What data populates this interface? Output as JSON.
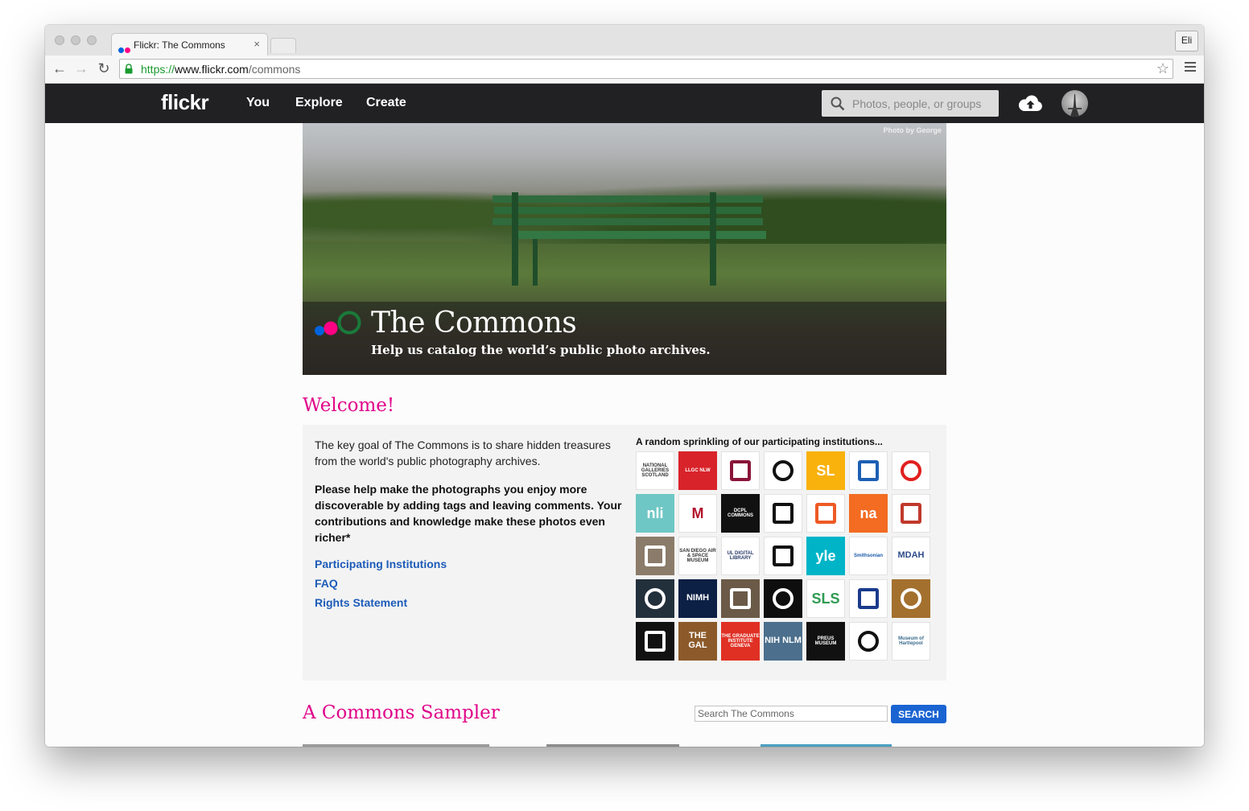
{
  "browser": {
    "tab_title": "Flickr: The Commons",
    "tab_close": "×",
    "profile_name": "Eli",
    "url_scheme": "https://",
    "url_host": "www.flickr.com",
    "url_path": "/commons",
    "nav_back": "←",
    "nav_forward": "→",
    "nav_reload": "↻",
    "star": "☆"
  },
  "flickr_header": {
    "logo": "flickr",
    "nav": [
      "You",
      "Explore",
      "Create"
    ],
    "search_placeholder": "Photos, people, or groups"
  },
  "hero": {
    "credit": "Photo by George",
    "title": "The Commons",
    "subtitle": "Help us catalog the world’s public photo archives."
  },
  "welcome": {
    "heading": "Welcome!",
    "intro": "The key goal of The Commons is to share hidden treasures from the world's public photography archives.",
    "call_to_action": "Please help make the photographs you enjoy more discoverable by adding tags and leaving comments. Your contributions and knowledge make these photos even richer*",
    "links": [
      "Participating Institutions",
      "FAQ",
      "Rights Statement"
    ],
    "institutions_heading": "A random sprinkling of our participating institutions...",
    "institutions": [
      {
        "text": "NATIONAL GALLERIES SCOTLAND",
        "bg": "#ffffff",
        "fg": "#333333"
      },
      {
        "text": "LLGC NLW",
        "bg": "#d8232a",
        "fg": "#ffffff"
      },
      {
        "text": "",
        "bg": "#ffffff",
        "fg": "#8a1538"
      },
      {
        "text": "",
        "bg": "#ffffff",
        "fg": "#111111"
      },
      {
        "text": "SL",
        "bg": "#f9b10b",
        "fg": "#ffffff"
      },
      {
        "text": "",
        "bg": "#ffffff",
        "fg": "#1d5fb4"
      },
      {
        "text": "",
        "bg": "#ffffff",
        "fg": "#e0201f"
      },
      {
        "text": "nli",
        "bg": "#6ec7c4",
        "fg": "#ffffff"
      },
      {
        "text": "M",
        "bg": "#ffffff",
        "fg": "#b3122b"
      },
      {
        "text": "DCPL COMMONS",
        "bg": "#111111",
        "fg": "#ffffff"
      },
      {
        "text": "",
        "bg": "#ffffff",
        "fg": "#111111"
      },
      {
        "text": "",
        "bg": "#ffffff",
        "fg": "#ee5a24"
      },
      {
        "text": "na",
        "bg": "#f36c21",
        "fg": "#ffffff"
      },
      {
        "text": "",
        "bg": "#ffffff",
        "fg": "#c0392b"
      },
      {
        "text": "",
        "bg": "#8a7b6a",
        "fg": "#ffffff"
      },
      {
        "text": "SAN DIEGO AIR & SPACE MUSEUM",
        "bg": "#ffffff",
        "fg": "#333333"
      },
      {
        "text": "UL DIGITAL LIBRARY",
        "bg": "#ffffff",
        "fg": "#2a3b6b"
      },
      {
        "text": "",
        "bg": "#ffffff",
        "fg": "#111111"
      },
      {
        "text": "yle",
        "bg": "#00b4c8",
        "fg": "#ffffff"
      },
      {
        "text": "Smithsonian",
        "bg": "#ffffff",
        "fg": "#1b5aa8"
      },
      {
        "text": "MDAH",
        "bg": "#ffffff",
        "fg": "#2d4b8a"
      },
      {
        "text": "",
        "bg": "#22303c",
        "fg": "#ffffff"
      },
      {
        "text": "NIMH",
        "bg": "#0c1f44",
        "fg": "#ffffff"
      },
      {
        "text": "",
        "bg": "#6b5a48",
        "fg": "#ffffff"
      },
      {
        "text": "",
        "bg": "#0e0e0e",
        "fg": "#ffffff"
      },
      {
        "text": "SLS",
        "bg": "#ffffff",
        "fg": "#2e9b52"
      },
      {
        "text": "",
        "bg": "#ffffff",
        "fg": "#1a3a8c"
      },
      {
        "text": "",
        "bg": "#a3702e",
        "fg": "#ffffff"
      },
      {
        "text": "",
        "bg": "#111111",
        "fg": "#ffffff"
      },
      {
        "text": "THE GAL",
        "bg": "#8c5a2a",
        "fg": "#ffffff"
      },
      {
        "text": "THE GRADUATE INSTITUTE GENEVA",
        "bg": "#e03024",
        "fg": "#ffffff"
      },
      {
        "text": "NIH NLM",
        "bg": "#4b6f8c",
        "fg": "#ffffff"
      },
      {
        "text": "PREUS MUSEUM",
        "bg": "#111111",
        "fg": "#ffffff"
      },
      {
        "text": "",
        "bg": "#ffffff",
        "fg": "#111111"
      },
      {
        "text": "Museum of Hartlepool",
        "bg": "#ffffff",
        "fg": "#3a6b8c"
      }
    ]
  },
  "sampler": {
    "heading": "A Commons Sampler",
    "search_placeholder": "Search The Commons",
    "search_button": "SEARCH"
  },
  "colors": {
    "accent_pink": "#e0068a",
    "link_blue": "#1d5bb8",
    "flickr_blue": "#0063dc",
    "flickr_pink": "#ff0084",
    "commons_green": "#1a7a3a"
  }
}
